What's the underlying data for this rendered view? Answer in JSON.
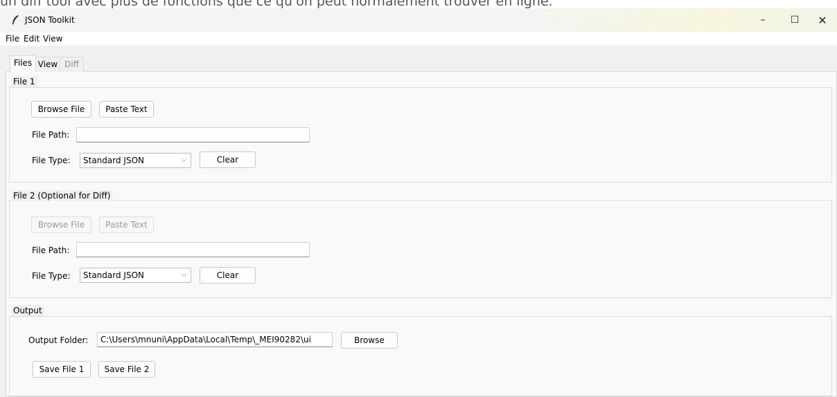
{
  "caption": "un diff tool avec plus de fonctions que ce qu'on peut normalement trouver en ligne.",
  "window": {
    "title": "JSON Toolkit",
    "controls": {
      "minimize": "–",
      "maximize": "☐",
      "close": "✕"
    }
  },
  "menubar": {
    "items": [
      "File",
      "Edit",
      "View"
    ]
  },
  "tabs": [
    {
      "label": "Files",
      "state": "active"
    },
    {
      "label": "View",
      "state": "normal"
    },
    {
      "label": "Diff",
      "state": "disabled"
    }
  ],
  "file1": {
    "title": "File 1",
    "browse_label": "Browse File",
    "paste_label": "Paste Text",
    "path_label": "File Path:",
    "path_value": "",
    "type_label": "File Type:",
    "type_value": "Standard JSON",
    "clear_label": "Clear"
  },
  "file2": {
    "title": "File 2 (Optional for Diff)",
    "browse_label": "Browse File",
    "paste_label": "Paste Text",
    "path_label": "File Path:",
    "path_value": "",
    "type_label": "File Type:",
    "type_value": "Standard JSON",
    "clear_label": "Clear"
  },
  "output": {
    "title": "Output",
    "folder_label": "Output Folder:",
    "folder_value": "C:\\Users\\mnuni\\AppData\\Local\\Temp\\_MEI90282\\ui",
    "browse_label": "Browse",
    "save1_label": "Save File 1",
    "save2_label": "Save File 2"
  },
  "icons": {
    "app": "feather-icon",
    "dropdown": "chevron-down-icon"
  },
  "colors": {
    "window_bg": "#f0f0f0",
    "disabled_text": "#9a9a9a"
  }
}
